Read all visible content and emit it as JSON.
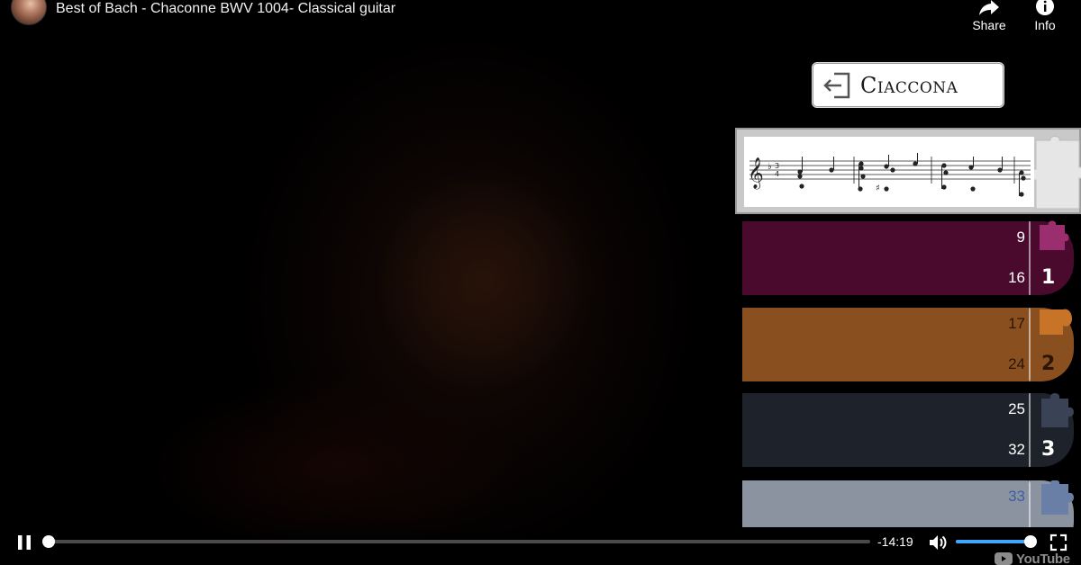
{
  "video": {
    "title": "Best of Bach - Chaconne BWV 1004- Classical guitar"
  },
  "top_actions": [
    {
      "label": "Share",
      "icon": "share-icon"
    },
    {
      "label": "Info",
      "icon": "info-icon"
    }
  ],
  "overlay": {
    "back_button_label": "Ciaccona",
    "back_icon": "exit-icon",
    "score_icon": "puzzle-piece-icon",
    "variations": [
      {
        "start": "9",
        "end": "16",
        "number": "1",
        "color": "#4a0a2e",
        "cap_color": "#4a0a2e",
        "puzzle_color": "#9a2e6e",
        "text_color": "#ffffff"
      },
      {
        "start": "17",
        "end": "24",
        "number": "2",
        "color": "#8a4f1e",
        "cap_color": "#8a4f1e",
        "puzzle_color": "#c87428",
        "text_color": "#2b1606"
      },
      {
        "start": "25",
        "end": "32",
        "number": "3",
        "color": "#1e222b",
        "cap_color": "#1e222b",
        "puzzle_color": "#3a4356",
        "text_color": "#ffffff"
      },
      {
        "start": "33",
        "end": "",
        "number": "",
        "color": "#8a939f",
        "cap_color": "#8a939f",
        "puzzle_color": "#6a7fa5",
        "text_color": "#3b5fa8"
      }
    ]
  },
  "player": {
    "time_remaining": "-14:19",
    "progress_fraction": 0.002,
    "volume_fraction": 0.99,
    "accent_color": "#3ea6ff",
    "logo_text": "YouTube",
    "icons": {
      "pause": "pause-icon",
      "volume": "volume-icon",
      "fullscreen": "fullscreen-icon"
    }
  }
}
